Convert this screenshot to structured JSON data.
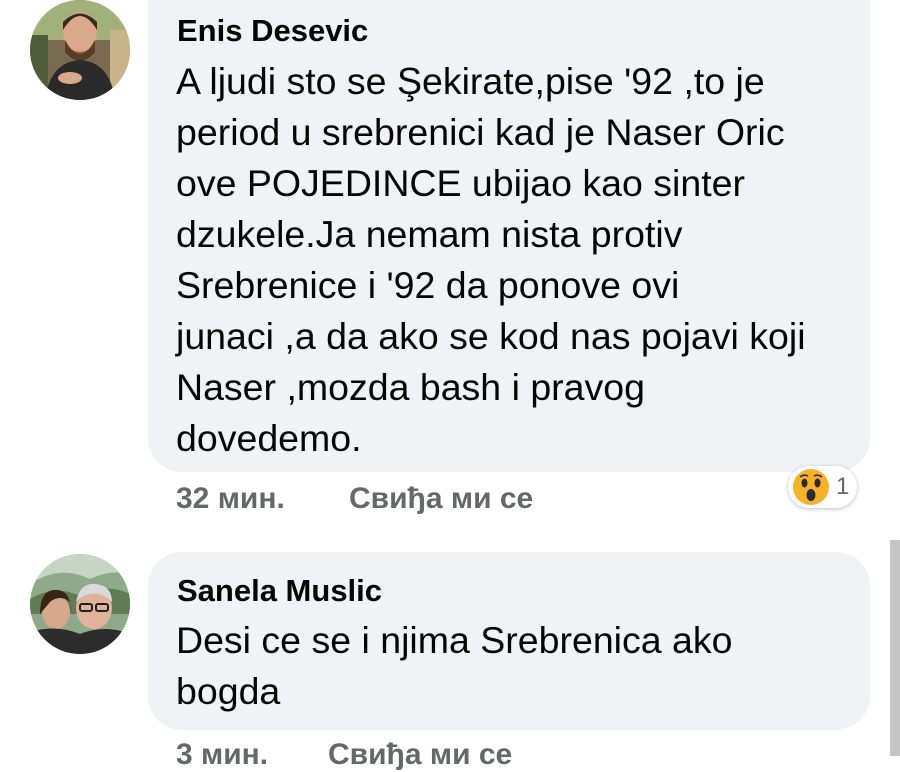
{
  "comments": [
    {
      "author": "Enis Desevic",
      "lines": [
        "A ljudi sto se Şekirate,pise '92 ,to je",
        "period u srebrenici kad je Naser Oric",
        "ove POJEDINCE ubijao kao sinter",
        "dzukele.Ja nemam nista protiv",
        "Srebrenice i '92 da ponove ovi",
        "junaci ,a da ako se kod nas pojavi koji",
        "Naser ,mozda bash i pravog",
        "dovedemo."
      ],
      "time": "32 мин.",
      "like_label": "Свиђа ми се",
      "reaction": {
        "icon": "wow-emoji-icon",
        "count": "1"
      }
    },
    {
      "author": "Sanela Muslic",
      "lines": [
        "Desi ce se i njima Srebrenica ako",
        "bogda"
      ],
      "time": "3 мин.",
      "like_label": "Свиђа ми се"
    }
  ],
  "colors": {
    "bubble": "#f0f2f5",
    "meta_text": "#65676b",
    "reaction_yellow": "#f7b125"
  }
}
